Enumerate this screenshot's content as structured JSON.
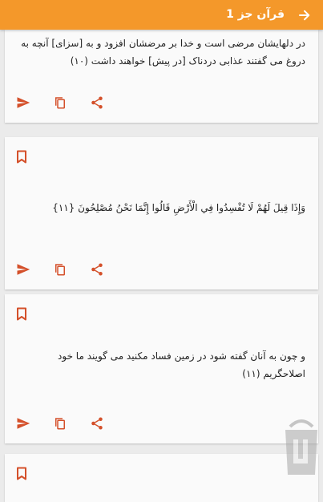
{
  "appbar": {
    "title": "قرآن جز 1",
    "back_icon": "arrow-right-icon",
    "background": "#f4982a"
  },
  "cards": [
    {
      "verse_text": "در دلهایشان مرضی است و خدا بر مرضشان افزود و به [سزای] آنچه به دروغ می گفتند عذابی دردناک [در پیش] خواهند داشت (۱۰)",
      "has_bookmark": false
    },
    {
      "verse_text": "وَإِذَا قِيلَ لَهُمْ لَا تُفْسِدُوا فِي الْأَرْضِ قَالُوا إِنَّمَا نَحْنُ مُصْلِحُونَ {١١}",
      "has_bookmark": true
    },
    {
      "verse_text": "و چون به آنان گفته شود در زمین فساد مکنید می گویند ما خود اصلاحگریم (۱۱)",
      "has_bookmark": true
    },
    {
      "verse_text": "",
      "has_bookmark": true
    }
  ],
  "icons": {
    "send": "send-icon",
    "copy": "copy-icon",
    "share": "share-icon",
    "bookmark": "bookmark-icon"
  },
  "accent_color": "#d4502a"
}
